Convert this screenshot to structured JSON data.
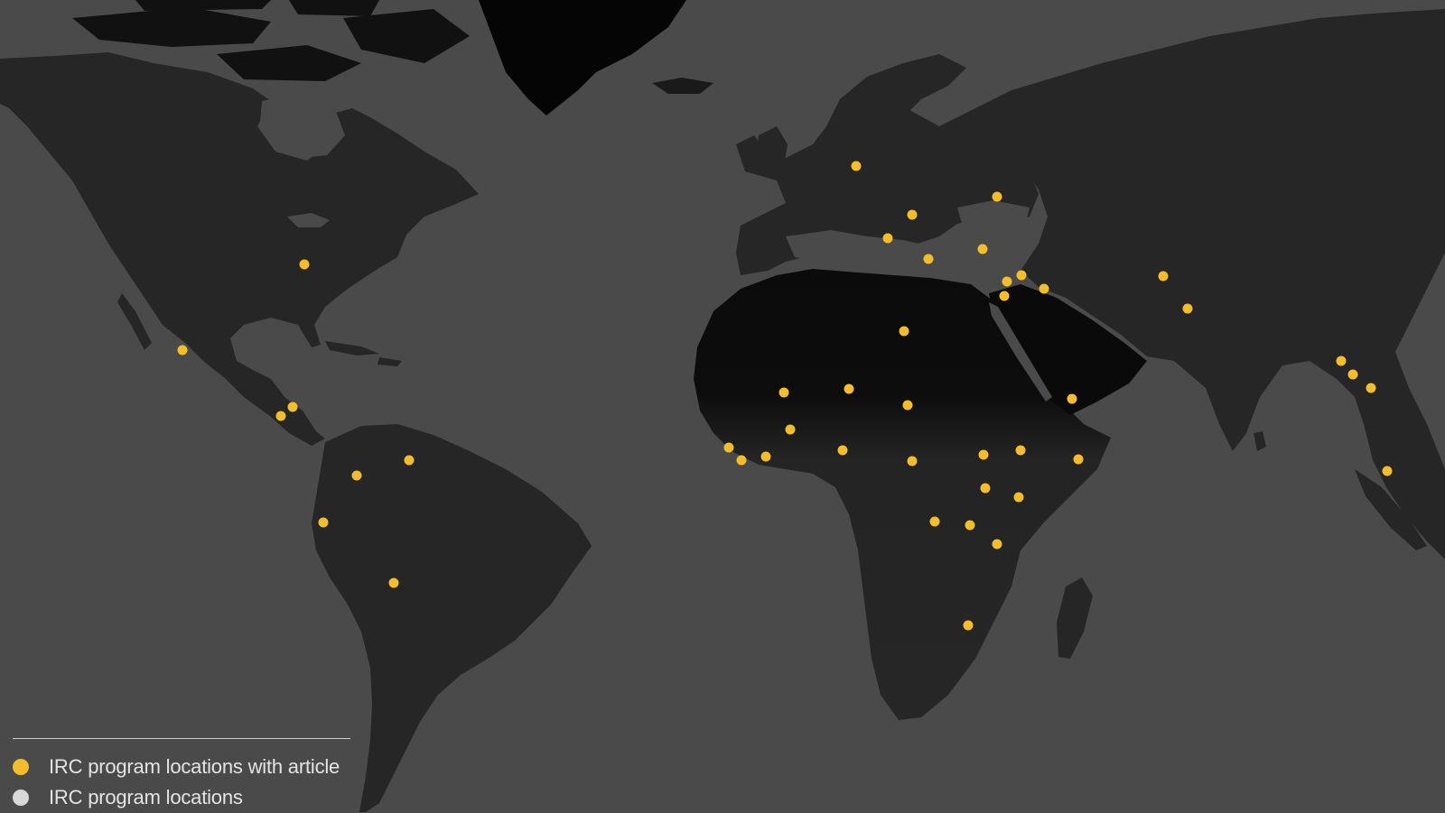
{
  "map": {
    "colors": {
      "ocean": "#4a4a4a",
      "land": "#262626",
      "desert": "#0c0c0c",
      "ice": "#050505",
      "marker_article": "#f5bd2c",
      "marker_program": "#d8d8d8"
    },
    "markers_with_article": [
      {
        "place": "United States"
      },
      {
        "place": "Mexico"
      },
      {
        "place": "El Salvador"
      },
      {
        "place": "Honduras"
      },
      {
        "place": "Colombia"
      },
      {
        "place": "Venezuela"
      },
      {
        "place": "Ecuador"
      },
      {
        "place": "Bolivia"
      },
      {
        "place": "Germany"
      },
      {
        "place": "Serbia"
      },
      {
        "place": "Italy"
      },
      {
        "place": "Greece"
      },
      {
        "place": "Ukraine"
      },
      {
        "place": "Turkey"
      },
      {
        "place": "Lebanon"
      },
      {
        "place": "Syria"
      },
      {
        "place": "Jordan"
      },
      {
        "place": "Iraq"
      },
      {
        "place": "Afghanistan"
      },
      {
        "place": "Pakistan"
      },
      {
        "place": "Libya"
      },
      {
        "place": "Mali"
      },
      {
        "place": "Niger"
      },
      {
        "place": "Chad"
      },
      {
        "place": "Burkina Faso"
      },
      {
        "place": "Guinea"
      },
      {
        "place": "Sierra Leone"
      },
      {
        "place": "Côte d'Ivoire"
      },
      {
        "place": "Nigeria"
      },
      {
        "place": "Central African Republic"
      },
      {
        "place": "South Sudan"
      },
      {
        "place": "Ethiopia"
      },
      {
        "place": "Somalia"
      },
      {
        "place": "Yemen"
      },
      {
        "place": "Uganda"
      },
      {
        "place": "Kenya"
      },
      {
        "place": "DR Congo (west)"
      },
      {
        "place": "DR Congo (east)"
      },
      {
        "place": "Tanzania"
      },
      {
        "place": "Zimbabwe"
      },
      {
        "place": "Bangladesh"
      },
      {
        "place": "Myanmar (north)"
      },
      {
        "place": "Myanmar (south)"
      },
      {
        "place": "Malaysia"
      }
    ]
  },
  "legend": {
    "items": [
      {
        "label": "IRC program locations with article",
        "color": "#f5bd2c"
      },
      {
        "label": "IRC program locations",
        "color": "#d8d8d8"
      }
    ]
  }
}
